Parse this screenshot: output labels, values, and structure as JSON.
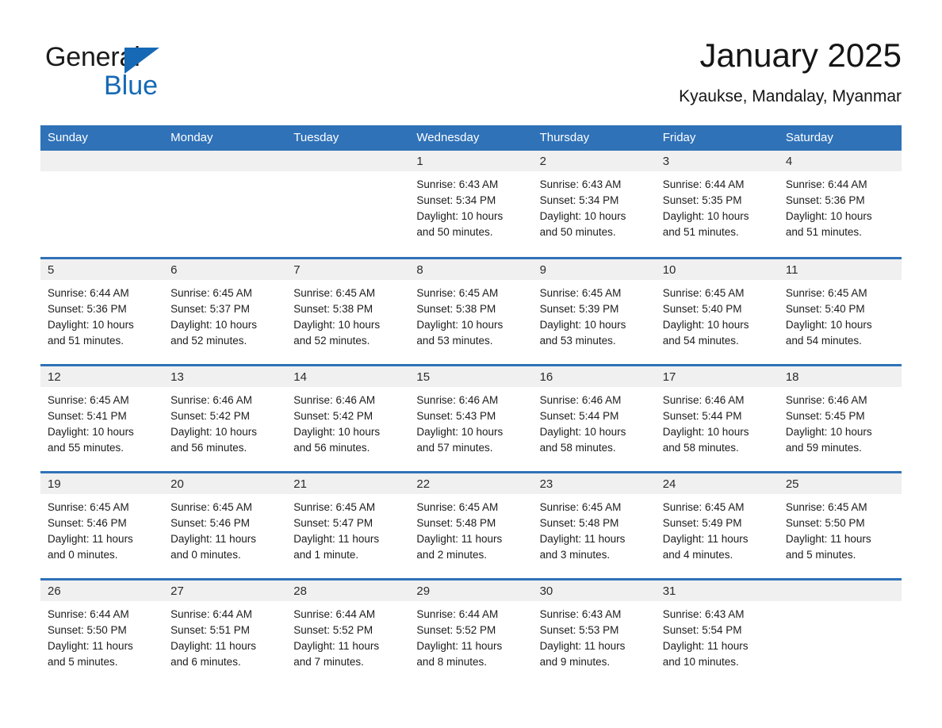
{
  "brand": {
    "name_part1": "General",
    "name_part2": "Blue",
    "logo_icon": "triangle-flag-icon",
    "accent_color": "#1669b5"
  },
  "header": {
    "month_title": "January 2025",
    "location": "Kyaukse, Mandalay, Myanmar"
  },
  "calendar": {
    "header_bg": "#2f72b8",
    "daynum_bg": "#f0f0f0",
    "weekdays": [
      "Sunday",
      "Monday",
      "Tuesday",
      "Wednesday",
      "Thursday",
      "Friday",
      "Saturday"
    ],
    "weeks": [
      [
        {
          "day": "",
          "sunrise": "",
          "sunset": "",
          "daylight1": "",
          "daylight2": ""
        },
        {
          "day": "",
          "sunrise": "",
          "sunset": "",
          "daylight1": "",
          "daylight2": ""
        },
        {
          "day": "",
          "sunrise": "",
          "sunset": "",
          "daylight1": "",
          "daylight2": ""
        },
        {
          "day": "1",
          "sunrise": "Sunrise: 6:43 AM",
          "sunset": "Sunset: 5:34 PM",
          "daylight1": "Daylight: 10 hours",
          "daylight2": "and 50 minutes."
        },
        {
          "day": "2",
          "sunrise": "Sunrise: 6:43 AM",
          "sunset": "Sunset: 5:34 PM",
          "daylight1": "Daylight: 10 hours",
          "daylight2": "and 50 minutes."
        },
        {
          "day": "3",
          "sunrise": "Sunrise: 6:44 AM",
          "sunset": "Sunset: 5:35 PM",
          "daylight1": "Daylight: 10 hours",
          "daylight2": "and 51 minutes."
        },
        {
          "day": "4",
          "sunrise": "Sunrise: 6:44 AM",
          "sunset": "Sunset: 5:36 PM",
          "daylight1": "Daylight: 10 hours",
          "daylight2": "and 51 minutes."
        }
      ],
      [
        {
          "day": "5",
          "sunrise": "Sunrise: 6:44 AM",
          "sunset": "Sunset: 5:36 PM",
          "daylight1": "Daylight: 10 hours",
          "daylight2": "and 51 minutes."
        },
        {
          "day": "6",
          "sunrise": "Sunrise: 6:45 AM",
          "sunset": "Sunset: 5:37 PM",
          "daylight1": "Daylight: 10 hours",
          "daylight2": "and 52 minutes."
        },
        {
          "day": "7",
          "sunrise": "Sunrise: 6:45 AM",
          "sunset": "Sunset: 5:38 PM",
          "daylight1": "Daylight: 10 hours",
          "daylight2": "and 52 minutes."
        },
        {
          "day": "8",
          "sunrise": "Sunrise: 6:45 AM",
          "sunset": "Sunset: 5:38 PM",
          "daylight1": "Daylight: 10 hours",
          "daylight2": "and 53 minutes."
        },
        {
          "day": "9",
          "sunrise": "Sunrise: 6:45 AM",
          "sunset": "Sunset: 5:39 PM",
          "daylight1": "Daylight: 10 hours",
          "daylight2": "and 53 minutes."
        },
        {
          "day": "10",
          "sunrise": "Sunrise: 6:45 AM",
          "sunset": "Sunset: 5:40 PM",
          "daylight1": "Daylight: 10 hours",
          "daylight2": "and 54 minutes."
        },
        {
          "day": "11",
          "sunrise": "Sunrise: 6:45 AM",
          "sunset": "Sunset: 5:40 PM",
          "daylight1": "Daylight: 10 hours",
          "daylight2": "and 54 minutes."
        }
      ],
      [
        {
          "day": "12",
          "sunrise": "Sunrise: 6:45 AM",
          "sunset": "Sunset: 5:41 PM",
          "daylight1": "Daylight: 10 hours",
          "daylight2": "and 55 minutes."
        },
        {
          "day": "13",
          "sunrise": "Sunrise: 6:46 AM",
          "sunset": "Sunset: 5:42 PM",
          "daylight1": "Daylight: 10 hours",
          "daylight2": "and 56 minutes."
        },
        {
          "day": "14",
          "sunrise": "Sunrise: 6:46 AM",
          "sunset": "Sunset: 5:42 PM",
          "daylight1": "Daylight: 10 hours",
          "daylight2": "and 56 minutes."
        },
        {
          "day": "15",
          "sunrise": "Sunrise: 6:46 AM",
          "sunset": "Sunset: 5:43 PM",
          "daylight1": "Daylight: 10 hours",
          "daylight2": "and 57 minutes."
        },
        {
          "day": "16",
          "sunrise": "Sunrise: 6:46 AM",
          "sunset": "Sunset: 5:44 PM",
          "daylight1": "Daylight: 10 hours",
          "daylight2": "and 58 minutes."
        },
        {
          "day": "17",
          "sunrise": "Sunrise: 6:46 AM",
          "sunset": "Sunset: 5:44 PM",
          "daylight1": "Daylight: 10 hours",
          "daylight2": "and 58 minutes."
        },
        {
          "day": "18",
          "sunrise": "Sunrise: 6:46 AM",
          "sunset": "Sunset: 5:45 PM",
          "daylight1": "Daylight: 10 hours",
          "daylight2": "and 59 minutes."
        }
      ],
      [
        {
          "day": "19",
          "sunrise": "Sunrise: 6:45 AM",
          "sunset": "Sunset: 5:46 PM",
          "daylight1": "Daylight: 11 hours",
          "daylight2": "and 0 minutes."
        },
        {
          "day": "20",
          "sunrise": "Sunrise: 6:45 AM",
          "sunset": "Sunset: 5:46 PM",
          "daylight1": "Daylight: 11 hours",
          "daylight2": "and 0 minutes."
        },
        {
          "day": "21",
          "sunrise": "Sunrise: 6:45 AM",
          "sunset": "Sunset: 5:47 PM",
          "daylight1": "Daylight: 11 hours",
          "daylight2": "and 1 minute."
        },
        {
          "day": "22",
          "sunrise": "Sunrise: 6:45 AM",
          "sunset": "Sunset: 5:48 PM",
          "daylight1": "Daylight: 11 hours",
          "daylight2": "and 2 minutes."
        },
        {
          "day": "23",
          "sunrise": "Sunrise: 6:45 AM",
          "sunset": "Sunset: 5:48 PM",
          "daylight1": "Daylight: 11 hours",
          "daylight2": "and 3 minutes."
        },
        {
          "day": "24",
          "sunrise": "Sunrise: 6:45 AM",
          "sunset": "Sunset: 5:49 PM",
          "daylight1": "Daylight: 11 hours",
          "daylight2": "and 4 minutes."
        },
        {
          "day": "25",
          "sunrise": "Sunrise: 6:45 AM",
          "sunset": "Sunset: 5:50 PM",
          "daylight1": "Daylight: 11 hours",
          "daylight2": "and 5 minutes."
        }
      ],
      [
        {
          "day": "26",
          "sunrise": "Sunrise: 6:44 AM",
          "sunset": "Sunset: 5:50 PM",
          "daylight1": "Daylight: 11 hours",
          "daylight2": "and 5 minutes."
        },
        {
          "day": "27",
          "sunrise": "Sunrise: 6:44 AM",
          "sunset": "Sunset: 5:51 PM",
          "daylight1": "Daylight: 11 hours",
          "daylight2": "and 6 minutes."
        },
        {
          "day": "28",
          "sunrise": "Sunrise: 6:44 AM",
          "sunset": "Sunset: 5:52 PM",
          "daylight1": "Daylight: 11 hours",
          "daylight2": "and 7 minutes."
        },
        {
          "day": "29",
          "sunrise": "Sunrise: 6:44 AM",
          "sunset": "Sunset: 5:52 PM",
          "daylight1": "Daylight: 11 hours",
          "daylight2": "and 8 minutes."
        },
        {
          "day": "30",
          "sunrise": "Sunrise: 6:43 AM",
          "sunset": "Sunset: 5:53 PM",
          "daylight1": "Daylight: 11 hours",
          "daylight2": "and 9 minutes."
        },
        {
          "day": "31",
          "sunrise": "Sunrise: 6:43 AM",
          "sunset": "Sunset: 5:54 PM",
          "daylight1": "Daylight: 11 hours",
          "daylight2": "and 10 minutes."
        },
        {
          "day": "",
          "sunrise": "",
          "sunset": "",
          "daylight1": "",
          "daylight2": ""
        }
      ]
    ]
  }
}
